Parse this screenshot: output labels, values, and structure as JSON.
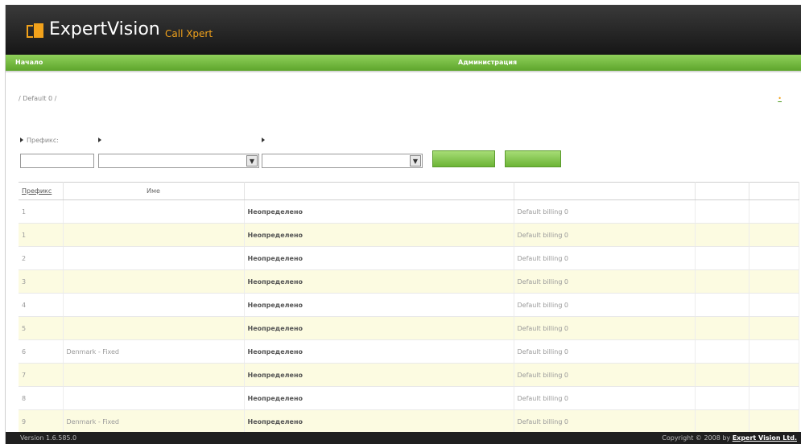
{
  "header": {
    "brand": "ExpertVision",
    "brand_sub": "Call Xpert"
  },
  "nav": {
    "items": [
      {
        "label": "Начало"
      },
      {
        "label": ""
      },
      {
        "label": ""
      },
      {
        "label": ""
      },
      {
        "label": "Администрация"
      },
      {
        "label": ""
      },
      {
        "label": ""
      }
    ]
  },
  "breadcrumb": {
    "root": "",
    "trail": "/ Default 0 /"
  },
  "add_link": "",
  "filters": {
    "prefix_label": "Префикс:",
    "type_label": "",
    "group_label": "",
    "search_button": "",
    "clear_button": ""
  },
  "table": {
    "headers": [
      "Префикс",
      "Име",
      "",
      "",
      "",
      ""
    ],
    "rows": [
      {
        "prefix": "1",
        "name": "",
        "type": "Неопределено",
        "group": "Default billing 0",
        "edit": "",
        "delete": ""
      },
      {
        "prefix": "1",
        "name": "",
        "type": "Неопределено",
        "group": "Default billing 0",
        "edit": "",
        "delete": ""
      },
      {
        "prefix": "2",
        "name": "",
        "type": "Неопределено",
        "group": "Default billing 0",
        "edit": "",
        "delete": ""
      },
      {
        "prefix": "3",
        "name": "",
        "type": "Неопределено",
        "group": "Default billing 0",
        "edit": "",
        "delete": ""
      },
      {
        "prefix": "4",
        "name": "",
        "type": "Неопределено",
        "group": "Default billing 0",
        "edit": "",
        "delete": ""
      },
      {
        "prefix": "5",
        "name": "",
        "type": "Неопределено",
        "group": "Default billing 0",
        "edit": "",
        "delete": ""
      },
      {
        "prefix": "6",
        "name": "Denmark - Fixed",
        "type": "Неопределено",
        "group": "Default billing 0",
        "edit": "",
        "delete": ""
      },
      {
        "prefix": "7",
        "name": "",
        "type": "Неопределено",
        "group": "Default billing 0",
        "edit": "",
        "delete": ""
      },
      {
        "prefix": "8",
        "name": "",
        "type": "Неопределено",
        "group": "Default billing 0",
        "edit": "",
        "delete": ""
      },
      {
        "prefix": "9",
        "name": "Denmark - Fixed",
        "type": "Неопределено",
        "group": "Default billing 0",
        "edit": "",
        "delete": ""
      }
    ]
  },
  "footer": {
    "version": "Version 1.6.585.0",
    "copyright_prefix": "Copyright © 2008 by",
    "copyright_owner": "Expert Vision Ltd."
  },
  "colors": {
    "nav_green": "#6cb536",
    "accent_orange": "#f2a21b",
    "row_highlight": "#fcfbe1"
  }
}
